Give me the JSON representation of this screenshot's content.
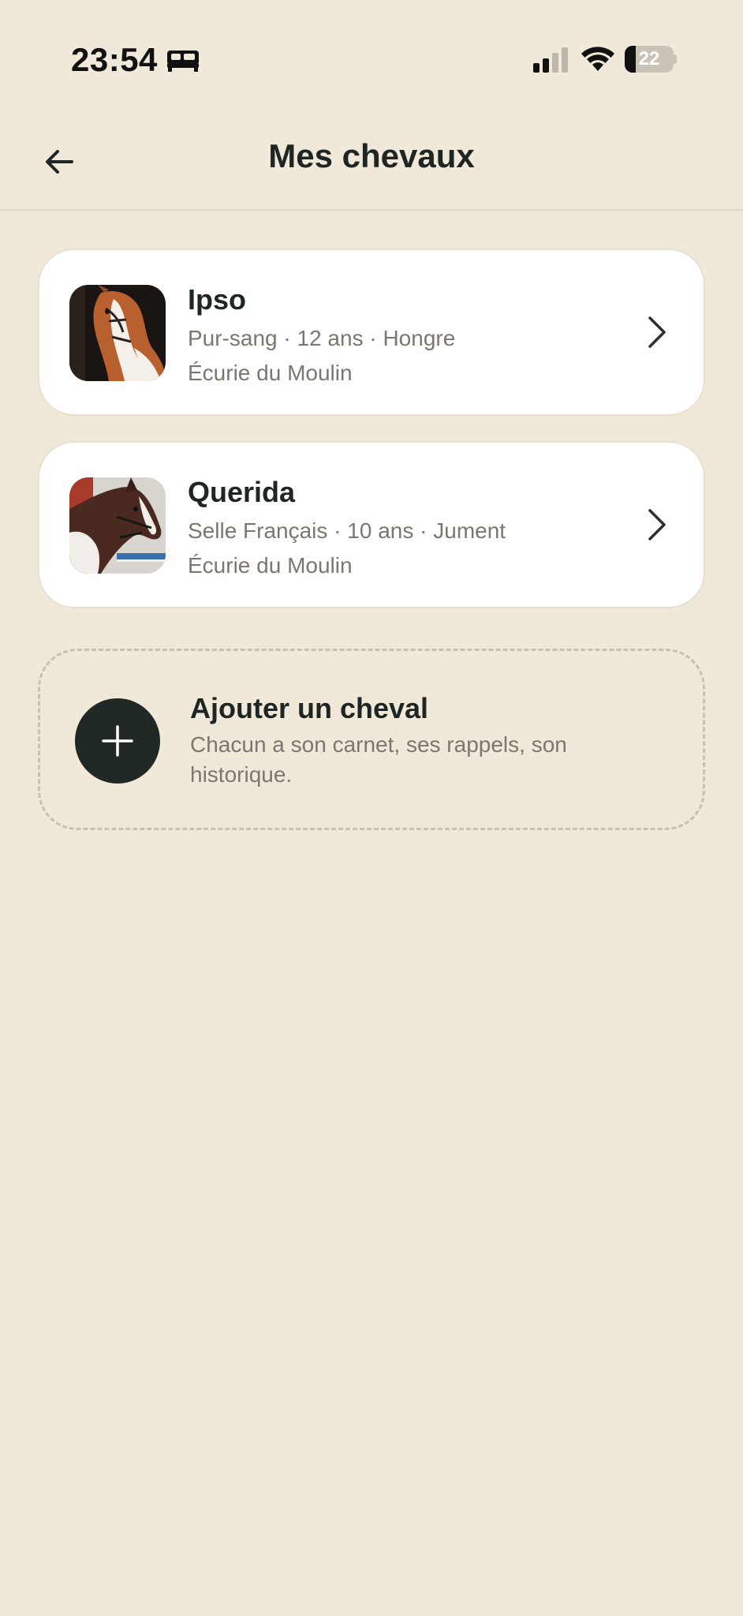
{
  "status_bar": {
    "time": "23:54",
    "battery_level": "22",
    "battery_fraction": 0.22,
    "icons": [
      "bed-icon",
      "signal-icon",
      "wifi-icon",
      "battery-icon"
    ]
  },
  "header": {
    "title": "Mes chevaux",
    "back_icon": "arrow-left-icon"
  },
  "horses": [
    {
      "name": "Ipso",
      "details": "Pur-sang · 12 ans · Hongre",
      "stable": "Écurie du Moulin",
      "photo": "horse-photo-ipso"
    },
    {
      "name": "Querida",
      "details": "Selle Français · 10 ans · Jument",
      "stable": "Écurie du Moulin",
      "photo": "horse-photo-querida"
    }
  ],
  "add_horse": {
    "title": "Ajouter un cheval",
    "subtitle": "Chacun a son carnet, ses rappels, son historique.",
    "icon": "plus-icon"
  },
  "colors": {
    "background": "#F0E8D9",
    "card": "#FFFFFF",
    "text_primary": "#1E2522",
    "text_secondary": "#7A7770",
    "accent_dark": "#1F2824"
  }
}
